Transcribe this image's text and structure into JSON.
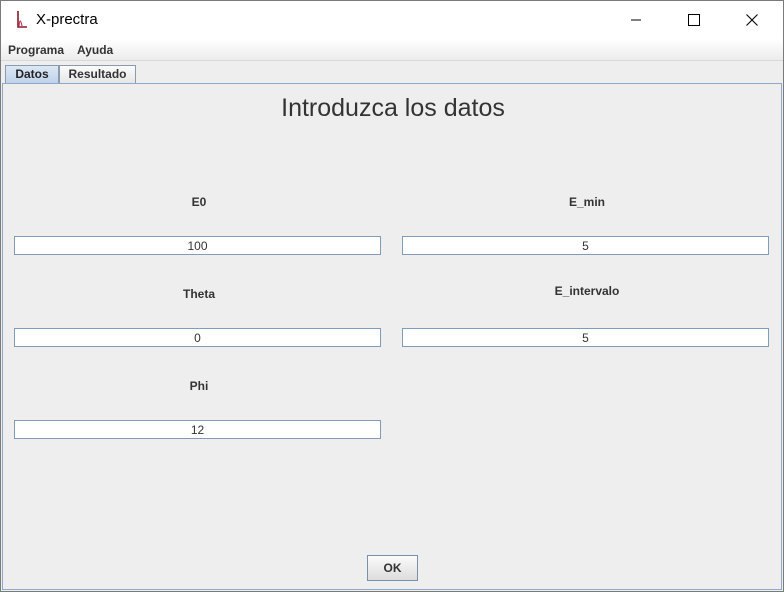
{
  "window": {
    "title": "X-prectra"
  },
  "menu": [
    "Programa",
    "Ayuda"
  ],
  "tabs": [
    "Datos",
    "Resultado"
  ],
  "heading": "Introduzca los datos",
  "fields": {
    "e0": {
      "label": "E0",
      "value": "100"
    },
    "e_min": {
      "label": "E_min",
      "value": "5"
    },
    "theta": {
      "label": "Theta",
      "value": "0"
    },
    "e_intervalo": {
      "label": "E_intervalo",
      "value": "5"
    },
    "phi": {
      "label": "Phi",
      "value": "12"
    }
  },
  "ok_label": "OK",
  "icons": {
    "app": "java-app-icon",
    "minimize": "minimize-icon",
    "maximize": "maximize-icon",
    "close": "close-icon"
  }
}
